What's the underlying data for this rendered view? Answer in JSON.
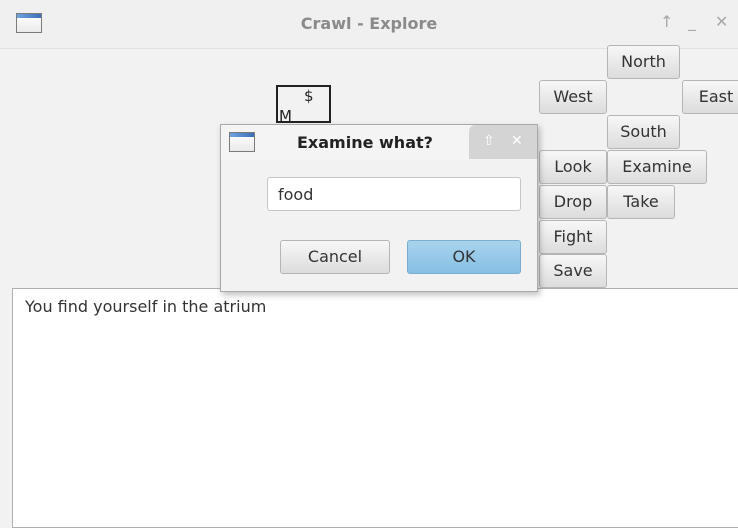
{
  "window": {
    "title": "Crawl - Explore",
    "controls": [
      "↑",
      "_",
      "✕"
    ]
  },
  "map": {
    "room_item": "$",
    "room_monster": "M"
  },
  "compass": {
    "north": "North",
    "west": "West",
    "east": "East",
    "south": "South"
  },
  "actions": {
    "look": "Look",
    "examine": "Examine",
    "drop": "Drop",
    "take": "Take",
    "fight": "Fight",
    "save": "Save"
  },
  "log": {
    "text": "You find yourself in the atrium"
  },
  "dialog": {
    "title": "Examine what?",
    "controls": [
      "⇧",
      "✕"
    ],
    "input_value": "food",
    "cancel_label": "Cancel",
    "ok_label": "OK"
  }
}
